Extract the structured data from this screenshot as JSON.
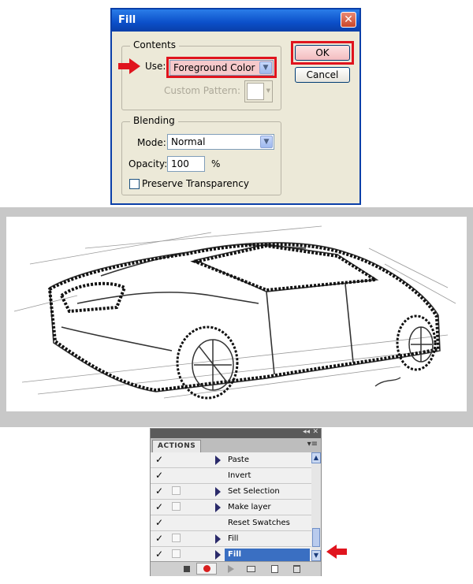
{
  "dialog": {
    "title": "Fill",
    "close_glyph": "✕",
    "contents": {
      "group_label": "Contents",
      "use_label": "Use:",
      "use_value": "Foreground Color",
      "custom_pattern_label": "Custom Pattern:"
    },
    "blending": {
      "group_label": "Blending",
      "mode_label": "Mode:",
      "mode_value": "Normal",
      "opacity_label": "Opacity:",
      "opacity_value": "100",
      "opacity_unit": "%",
      "preserve_label": "Preserve Transparency",
      "preserve_checked": false
    },
    "buttons": {
      "ok": "OK",
      "cancel": "Cancel"
    }
  },
  "actions_panel": {
    "tab_label": "ACTIONS",
    "rows": [
      {
        "name": "Paste",
        "checked": true,
        "has_toggle": false,
        "expandable": true,
        "selected": false
      },
      {
        "name": "Invert",
        "checked": true,
        "has_toggle": false,
        "expandable": false,
        "selected": false
      },
      {
        "name": "Set Selection",
        "checked": true,
        "has_toggle": true,
        "expandable": true,
        "selected": false
      },
      {
        "name": "Make layer",
        "checked": true,
        "has_toggle": true,
        "expandable": true,
        "selected": false
      },
      {
        "name": "Reset Swatches",
        "checked": true,
        "has_toggle": false,
        "expandable": false,
        "selected": false
      },
      {
        "name": "Fill",
        "checked": true,
        "has_toggle": true,
        "expandable": true,
        "selected": false
      },
      {
        "name": "Fill",
        "checked": true,
        "has_toggle": true,
        "expandable": true,
        "selected": true
      }
    ]
  },
  "colors": {
    "highlight": "#e0141e",
    "selection": "#3a6fc2",
    "title_bar": "#0b4fc9"
  },
  "icons": [
    "arrow-right-annotation",
    "close-icon",
    "chevron-down-icon",
    "stop-icon",
    "record-icon",
    "play-icon",
    "folder-icon",
    "new-action-icon",
    "trash-icon",
    "arrow-left-annotation"
  ]
}
